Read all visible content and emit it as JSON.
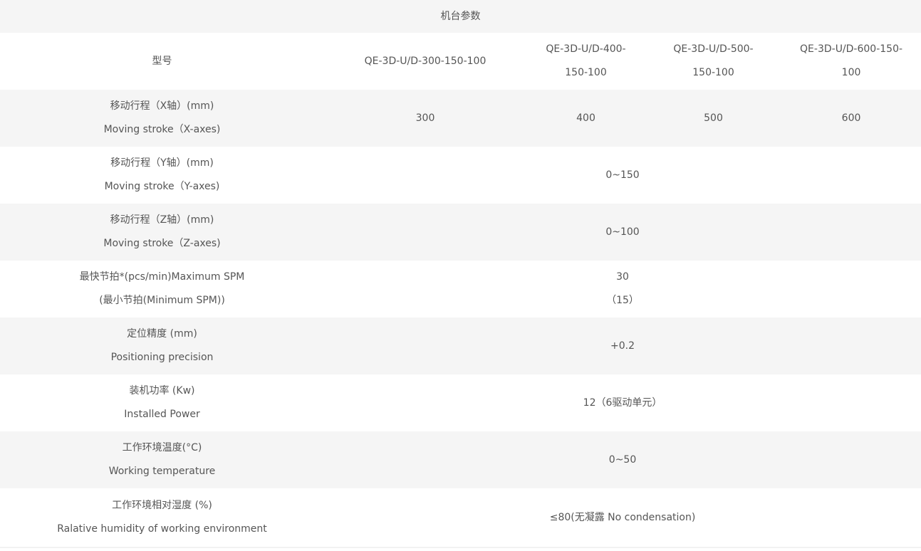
{
  "table": {
    "title": "机台参数",
    "model_label": "型号",
    "models": [
      [
        "QE-3D-U/D-300-150-100"
      ],
      [
        "QE-3D-U/D-400-",
        "150-100"
      ],
      [
        "QE-3D-U/D-500-",
        "150-100"
      ],
      [
        "QE-3D-U/D-600-150-",
        "100"
      ]
    ],
    "x_stroke": {
      "label_cn": "移动行程（X轴）(mm)",
      "label_en": "Moving stroke（X-axes)",
      "values": [
        "300",
        "400",
        "500",
        "600"
      ]
    },
    "y_stroke": {
      "label_cn": "移动行程（Y轴）(mm)",
      "label_en": "Moving stroke（Y-axes)",
      "value": "0~150"
    },
    "z_stroke": {
      "label_cn": "移动行程（Z轴）(mm)",
      "label_en": "Moving stroke（Z-axes)",
      "value": "0~100"
    },
    "spm": {
      "label_cn": "最快节拍*(pcs/min)Maximum SPM",
      "label_en": "(最小节拍(Minimum SPM))",
      "value": "30",
      "value2": "（15）"
    },
    "precision": {
      "label_cn": "定位精度 (mm)",
      "label_en": "Positioning precision",
      "value": "+0.2"
    },
    "power": {
      "label_cn": "装机功率 (Kw)",
      "label_en": "Installed Power",
      "value": "12（6驱动单元）"
    },
    "temperature": {
      "label_cn": "工作环境温度(°C)",
      "label_en": "Working temperature",
      "value": "0~50"
    },
    "humidity": {
      "label_cn": "工作环境相对湿度 (%)",
      "label_en": "Ralative humidity of working environment",
      "value": "≤80(无凝露 No condensation)"
    }
  }
}
